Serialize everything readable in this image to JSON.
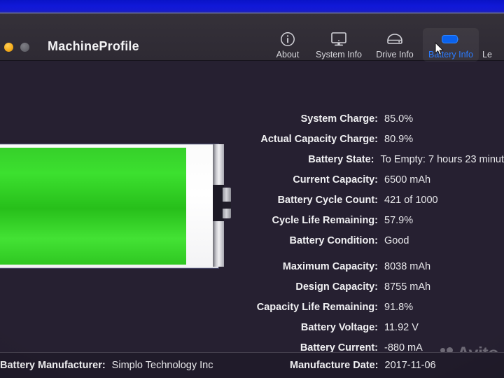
{
  "window": {
    "title": "MachineProfile",
    "traffic_lights": [
      "minimize",
      "zoom"
    ]
  },
  "toolbar": {
    "tabs": [
      {
        "label": "About",
        "icon": "info-circle-icon",
        "selected": false
      },
      {
        "label": "System Info",
        "icon": "desktop-monitor-icon",
        "selected": false
      },
      {
        "label": "Drive Info",
        "icon": "hard-drive-icon",
        "selected": false
      },
      {
        "label": "Battery Info",
        "icon": "battery-icon",
        "selected": true
      },
      {
        "label": "Le",
        "icon": "clipped-icon",
        "selected": false
      }
    ],
    "selected_color": "#2a7bff",
    "cursor": "arrow-pointer"
  },
  "battery_graphic": {
    "fill_percent": 85,
    "fill_color": "#32cf24",
    "body_color": "#ffffff"
  },
  "stats_primary": [
    {
      "key": "System Charge:",
      "value": "85.0%"
    },
    {
      "key": "Actual Capacity Charge:",
      "value": "80.9%"
    },
    {
      "key": "Battery State:",
      "value": "To Empty: 7 hours 23 minut"
    },
    {
      "key": "Current Capacity:",
      "value": "6500 mAh"
    },
    {
      "key": "Battery Cycle Count:",
      "value": "421 of 1000"
    },
    {
      "key": "Cycle Life Remaining:",
      "value": "57.9%"
    },
    {
      "key": "Battery Condition:",
      "value": "Good"
    }
  ],
  "stats_secondary": [
    {
      "key": "Maximum Capacity:",
      "value": "8038 mAh"
    },
    {
      "key": "Design Capacity:",
      "value": "8755 mAh"
    },
    {
      "key": "Capacity Life Remaining:",
      "value": "91.8%"
    },
    {
      "key": "Battery Voltage:",
      "value": "11.92 V"
    },
    {
      "key": "Battery Current:",
      "value": "-880 mA"
    }
  ],
  "footer": {
    "manufacturer_label": "Battery Manufacturer:",
    "manufacturer_value": "Simplo Technology Inc",
    "date_label": "Manufacture Date:",
    "date_value": "2017-11-06"
  },
  "watermark": {
    "text": "Avito"
  }
}
